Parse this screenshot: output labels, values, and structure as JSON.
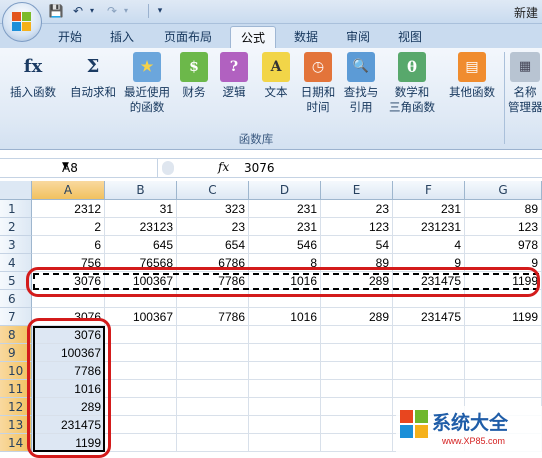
{
  "window": {
    "title": "新建"
  },
  "quick_access": {
    "save_icon": "save-icon",
    "undo_icon": "undo-icon",
    "redo_icon": "redo-icon"
  },
  "tabs": [
    {
      "label": "开始",
      "active": false
    },
    {
      "label": "插入",
      "active": false
    },
    {
      "label": "页面布局",
      "active": false
    },
    {
      "label": "公式",
      "active": true
    },
    {
      "label": "数据",
      "active": false
    },
    {
      "label": "审阅",
      "active": false
    },
    {
      "label": "视图",
      "active": false
    }
  ],
  "ribbon": {
    "group_label": "函数库",
    "buttons": [
      {
        "line1": "插入函数",
        "line2": "",
        "icon_text": "fx"
      },
      {
        "line1": "自动求和",
        "line2": "",
        "icon_text": "Σ"
      },
      {
        "line1": "最近使用",
        "line2": "的函数",
        "icon_text": "★"
      },
      {
        "line1": "财务",
        "line2": "",
        "icon_text": "$"
      },
      {
        "line1": "逻辑",
        "line2": "",
        "icon_text": "?"
      },
      {
        "line1": "文本",
        "line2": "",
        "icon_text": "A"
      },
      {
        "line1": "日期和",
        "line2": "时间",
        "icon_text": "◷"
      },
      {
        "line1": "查找与",
        "line2": "引用",
        "icon_text": "🔍"
      },
      {
        "line1": "数学和",
        "line2": "三角函数",
        "icon_text": "θ"
      },
      {
        "line1": "其他函数",
        "line2": "",
        "icon_text": "▤"
      }
    ],
    "name_manager": {
      "line1": "名称",
      "line2": "管理器"
    }
  },
  "formula_bar": {
    "name_box": "A8",
    "fx_label": "fx",
    "value": "3076"
  },
  "columns": [
    "A",
    "B",
    "C",
    "D",
    "E",
    "F",
    "G"
  ],
  "rows": [
    {
      "num": "1",
      "cells": [
        "2312",
        "31",
        "323",
        "231",
        "23",
        "231",
        "89"
      ]
    },
    {
      "num": "2",
      "cells": [
        "2",
        "23123",
        "23",
        "231",
        "123",
        "231231",
        "123"
      ]
    },
    {
      "num": "3",
      "cells": [
        "6",
        "645",
        "654",
        "546",
        "54",
        "4",
        "978"
      ]
    },
    {
      "num": "4",
      "cells": [
        "756",
        "76568",
        "6786",
        "8",
        "89",
        "9",
        "9"
      ]
    },
    {
      "num": "5",
      "cells": [
        "3076",
        "100367",
        "7786",
        "1016",
        "289",
        "231475",
        "1199"
      ]
    },
    {
      "num": "6",
      "cells": [
        "",
        "",
        "",
        "",
        "",
        "",
        ""
      ]
    },
    {
      "num": "7",
      "cells": [
        "3076",
        "100367",
        "7786",
        "1016",
        "289",
        "231475",
        "1199"
      ]
    },
    {
      "num": "8",
      "cells": [
        "3076",
        "",
        "",
        "",
        "",
        "",
        ""
      ]
    },
    {
      "num": "9",
      "cells": [
        "100367",
        "",
        "",
        "",
        "",
        "",
        ""
      ]
    },
    {
      "num": "10",
      "cells": [
        "7786",
        "",
        "",
        "",
        "",
        "",
        ""
      ]
    },
    {
      "num": "11",
      "cells": [
        "1016",
        "",
        "",
        "",
        "",
        "",
        ""
      ]
    },
    {
      "num": "12",
      "cells": [
        "289",
        "",
        "",
        "",
        "",
        "",
        ""
      ]
    },
    {
      "num": "13",
      "cells": [
        "231475",
        "",
        "",
        "",
        "",
        "",
        ""
      ]
    },
    {
      "num": "14",
      "cells": [
        "1199",
        "",
        "",
        "",
        "",
        "",
        ""
      ]
    }
  ],
  "watermark": {
    "title": "系统大全",
    "url": "www.XP85.com"
  },
  "colors": {
    "accent_red": "#d31b1b",
    "selection": "#dde7f3",
    "header_selected": "#f1c15f"
  }
}
